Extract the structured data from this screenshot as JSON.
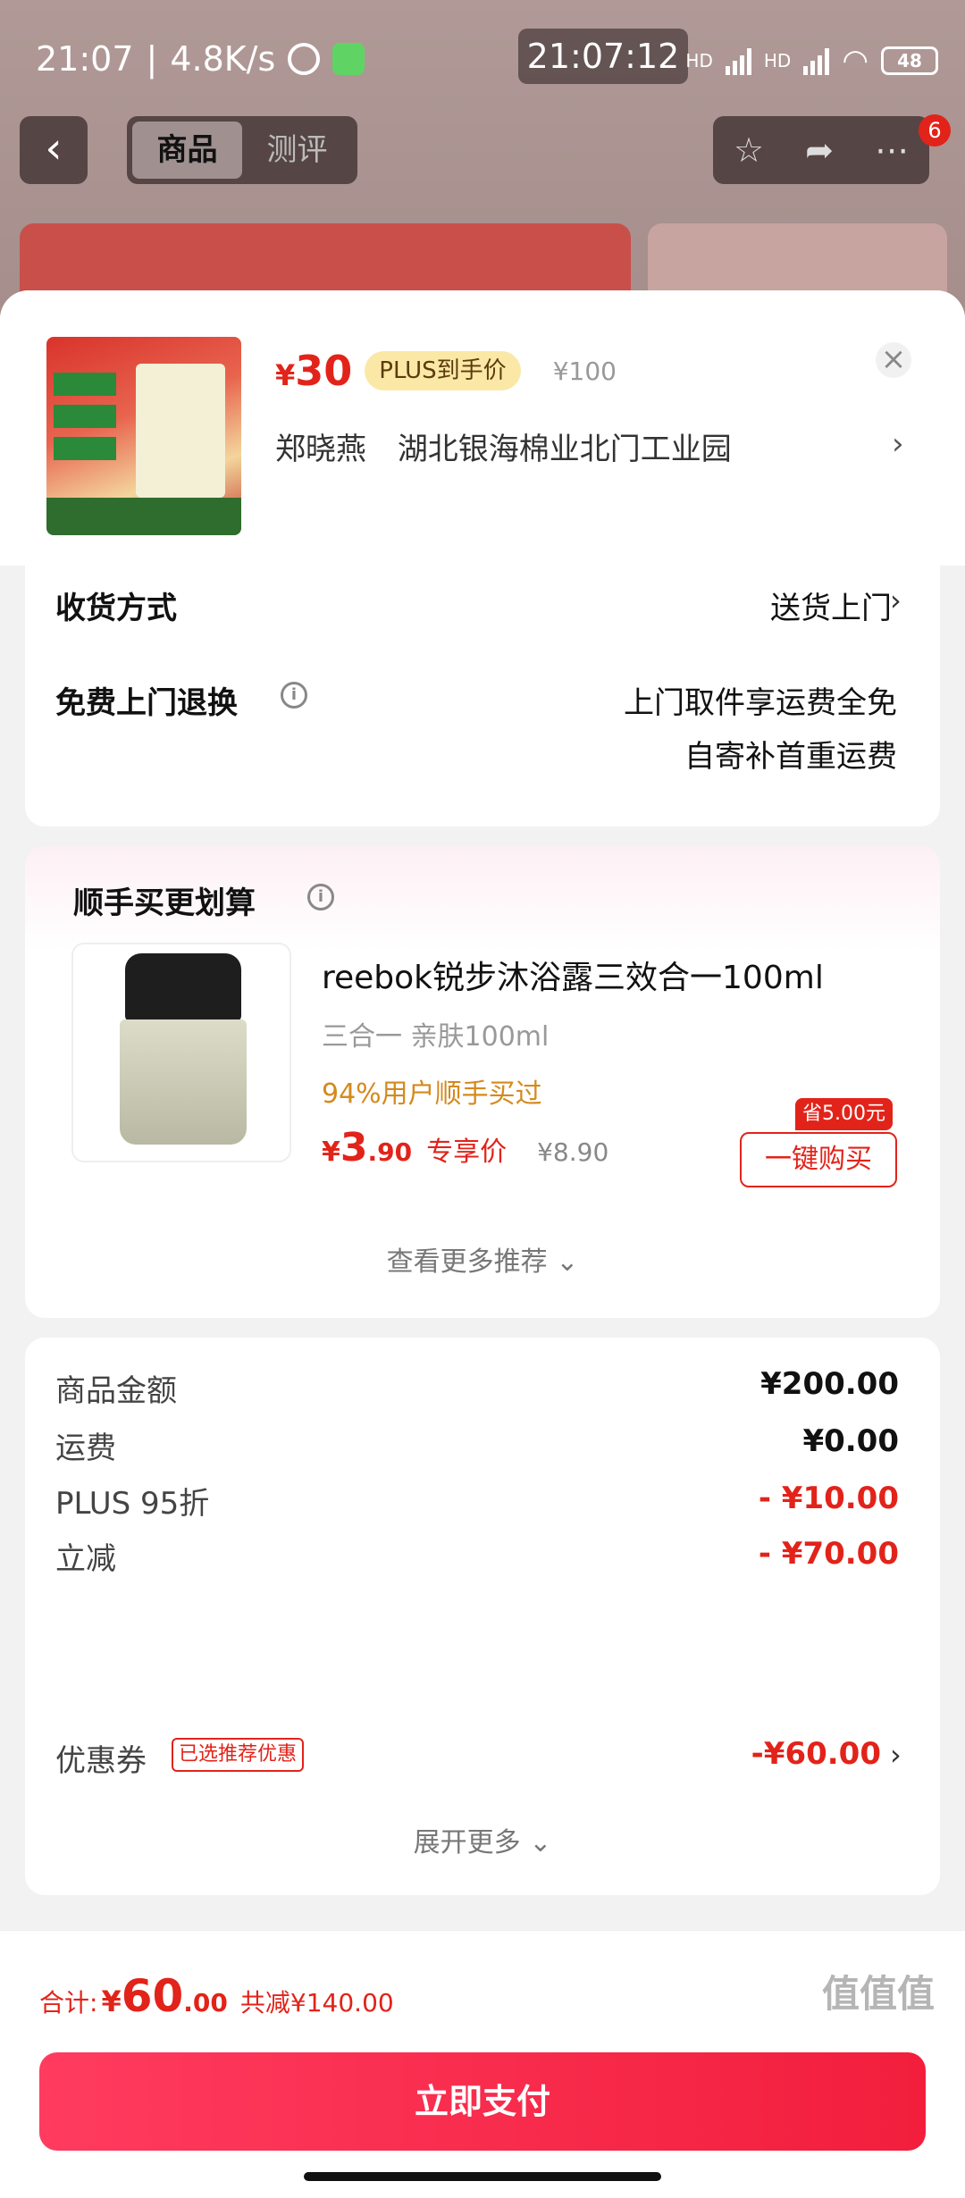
{
  "status_bar": {
    "time": "21:07",
    "speed": "4.8K/s",
    "center_time": "21:07:12",
    "battery": "48",
    "hd1": "HD",
    "hd2": "HD"
  },
  "nav": {
    "tabs": [
      {
        "label": "商品",
        "active": true
      },
      {
        "label": "测评",
        "active": false
      }
    ],
    "badge": "6"
  },
  "product": {
    "price_currency": "¥",
    "price": "30",
    "plus_tag": "PLUS到手价",
    "original_price": "¥100",
    "recipient": "郑晓燕",
    "address": "湖北银海棉业北门工业园"
  },
  "delivery": {
    "method_label": "收货方式",
    "method_value": "送货上门",
    "return_label": "免费上门退换",
    "return_value_1": "上门取件享运费全免",
    "return_value_2": "自寄补首重运费"
  },
  "recommend": {
    "title": "顺手买更划算",
    "item": {
      "name": "reebok锐步沐浴露三效合一100ml",
      "spec": "三合一 亲肤100ml",
      "bought": "94%用户顺手买过",
      "price_currency": "¥",
      "price_int": "3",
      "price_dec": ".90",
      "price_tag": "专享价",
      "original_price": "¥8.90",
      "save_tag": "省5.00元",
      "buy_label": "一键购买"
    },
    "more_label": "查看更多推荐"
  },
  "summary": {
    "rows": [
      {
        "label": "商品金额",
        "value": "¥200.00",
        "red": false
      },
      {
        "label": "运费",
        "value": "¥0.00",
        "red": false
      },
      {
        "label": "PLUS 95折",
        "value": "- ¥10.00",
        "red": true
      },
      {
        "label": "立减",
        "value": "- ¥70.00",
        "red": true
      },
      {
        "label": "优惠券",
        "value": "-¥60.00",
        "red": true
      }
    ],
    "coupon_tag": "已选推荐优惠",
    "expand_label": "展开更多"
  },
  "footer": {
    "total_label": "合计:",
    "total_currency": "¥",
    "total_int": "60",
    "total_dec": ".00",
    "saved": "共减¥140.00",
    "pay_label": "立即支付",
    "watermark": "值值值"
  },
  "colors": {
    "accent_red": "#e2231a",
    "pay_button": "#f21e3c",
    "plus_tag_bg": "#fbe8a6",
    "bought_orange": "#d48a1d"
  }
}
